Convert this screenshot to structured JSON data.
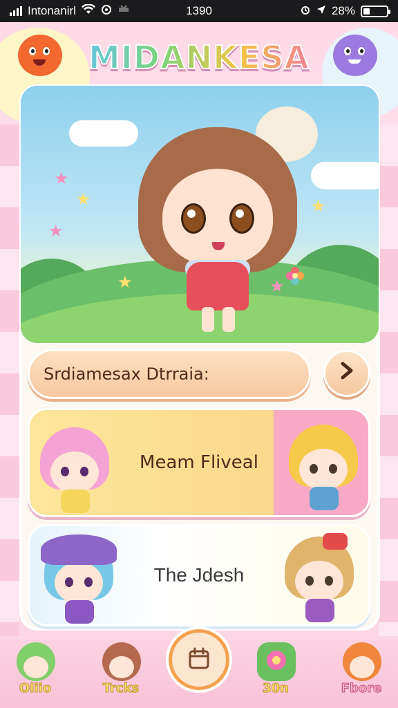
{
  "status_bar": {
    "carrier": "Intonanirl",
    "time": "1390",
    "battery": "28%",
    "battery_level": 0.28
  },
  "app": {
    "logo_text": "MIDANKESA"
  },
  "search_row": {
    "label": "Srdiamesax Dtrraia:"
  },
  "cards": [
    {
      "title": "Meam Fliveal"
    },
    {
      "title": "The Jdesh"
    }
  ],
  "bottom_nav": {
    "items": [
      {
        "label": "Oliio",
        "label_color": "#f7e070"
      },
      {
        "label": "Trcks",
        "label_color": "#f7e070"
      },
      {
        "label": "30n",
        "label_color": "#f7e070"
      },
      {
        "label": "Fbore",
        "label_color": "#f9b2cc"
      }
    ],
    "center_icon": "calendar-icon"
  },
  "colors": {
    "accent_orange": "#f5a24e",
    "text_brown": "#4e2a1a",
    "panel_bg": "#fdf7f1"
  }
}
